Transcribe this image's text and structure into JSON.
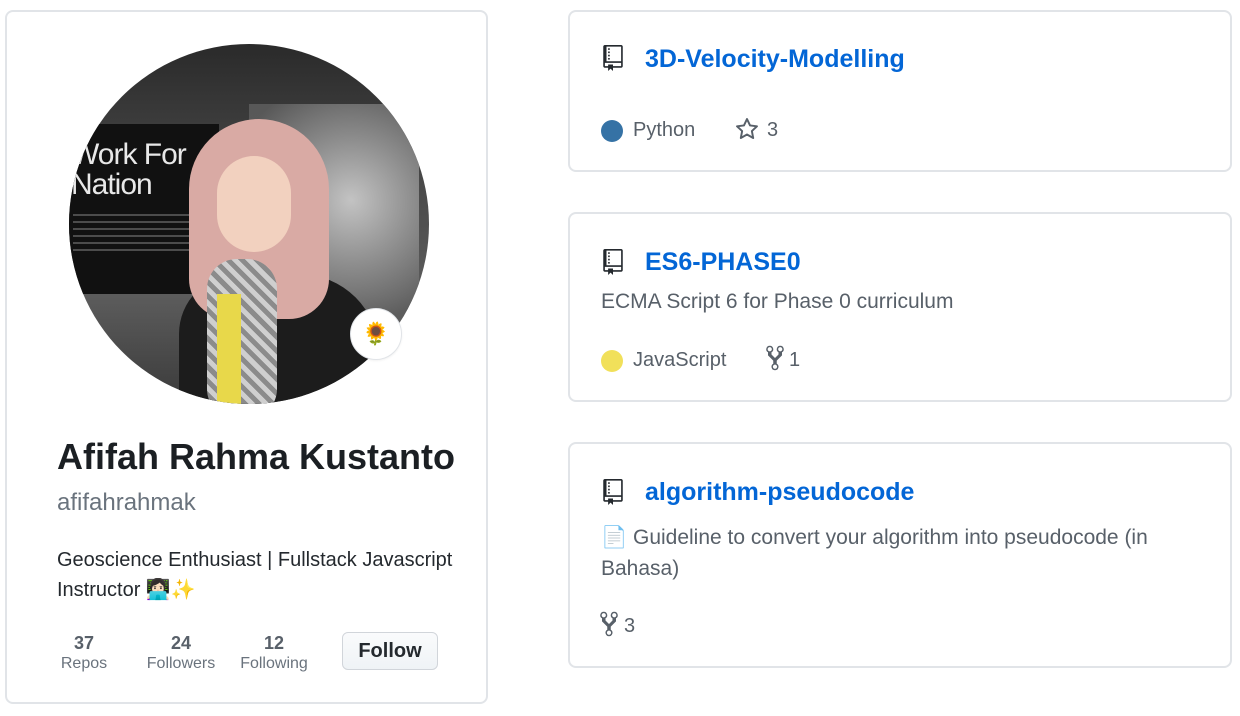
{
  "profile": {
    "name": "Afifah Rahma Kustanto",
    "username": "afifahrahmak",
    "bio": "Geoscience Enthusiast | Fullstack Javascript Instructor 👩🏻‍💻✨",
    "status_emoji": "🌻",
    "avatar_background_text": "Work For Nation",
    "stats": [
      {
        "value": "37",
        "label": "Repos"
      },
      {
        "value": "24",
        "label": "Followers"
      },
      {
        "value": "12",
        "label": "Following"
      }
    ],
    "follow_label": "Follow"
  },
  "repos": [
    {
      "name": "3D-Velocity-Modelling",
      "description": "",
      "language": "Python",
      "language_color": "#3572A5",
      "stars": "3",
      "forks": ""
    },
    {
      "name": "ES6-PHASE0",
      "description": "ECMA Script 6 for Phase 0 curriculum",
      "language": "JavaScript",
      "language_color": "#f1e05a",
      "stars": "",
      "forks": "1"
    },
    {
      "name": "algorithm-pseudocode",
      "description": "📄 Guideline to convert your algorithm into pseudocode (in Bahasa)",
      "language": "",
      "language_color": "",
      "stars": "",
      "forks": "3"
    }
  ],
  "colors": {
    "link": "#0366d6",
    "muted": "#586069",
    "border": "#e1e4e8"
  }
}
